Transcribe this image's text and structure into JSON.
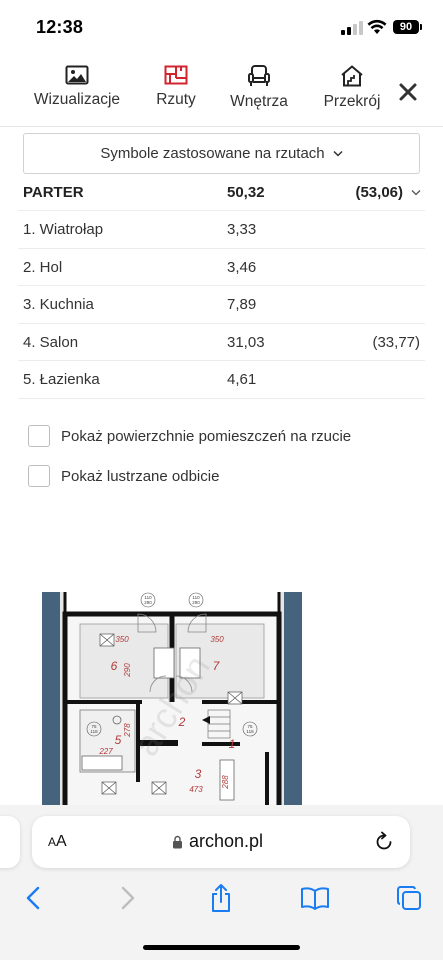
{
  "status": {
    "time": "12:38",
    "battery": "90"
  },
  "nav": {
    "tabs": [
      {
        "label": "Wizualizacje",
        "icon": "image-icon"
      },
      {
        "label": "Rzuty",
        "icon": "floor-plan-icon",
        "active": true
      },
      {
        "label": "Wnętrza",
        "icon": "armchair-icon"
      },
      {
        "label": "Przekrój",
        "icon": "house-section-icon"
      }
    ],
    "close_icon": "close-icon"
  },
  "colors": {
    "accent": "#d0252e",
    "text": "#333333",
    "border": "#d2d2d2"
  },
  "dropdown": {
    "label": "Symbole zastosowane na rzutach"
  },
  "table": {
    "header": {
      "name": "PARTER",
      "area": "50,32",
      "area_alt": "(53,06)"
    },
    "rows": [
      {
        "name": "1. Wiatrołap",
        "area": "3,33",
        "area_alt": ""
      },
      {
        "name": "2. Hol",
        "area": "3,46",
        "area_alt": ""
      },
      {
        "name": "3. Kuchnia",
        "area": "7,89",
        "area_alt": ""
      },
      {
        "name": "4. Salon",
        "area": "31,03",
        "area_alt": "(33,77)"
      },
      {
        "name": "5. Łazienka",
        "area": "4,61",
        "area_alt": ""
      }
    ]
  },
  "options": {
    "show_areas": "Pokaż powierzchnie pomieszczeń na rzucie",
    "show_mirror": "Pokaż lustrzane odbicie"
  },
  "floorplan": {
    "room_numbers": [
      "6",
      "7",
      "2",
      "5",
      "1",
      "3"
    ],
    "dimensions": [
      "350",
      "350",
      "290",
      "278",
      "227",
      "473",
      "288"
    ],
    "window_tags": [
      "110\n290",
      "110\n290",
      "75\n118",
      "75\n118"
    ],
    "watermark": "archon"
  },
  "browser": {
    "aa_label_small": "A",
    "aa_label": "A",
    "url": "archon.pl"
  }
}
